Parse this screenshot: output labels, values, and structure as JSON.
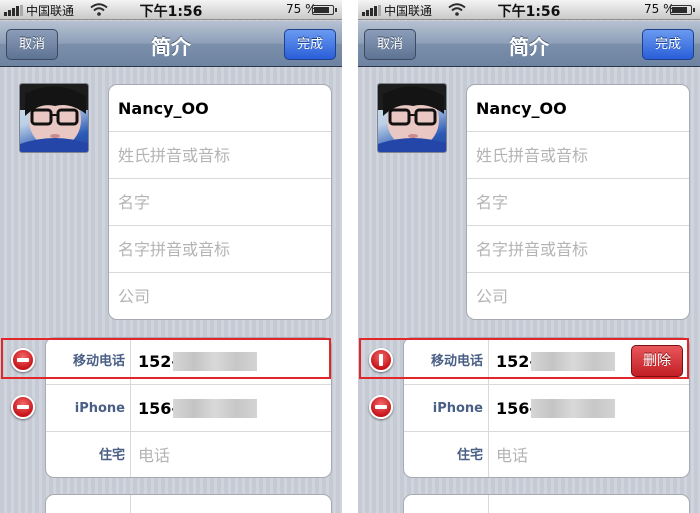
{
  "status_bar": {
    "carrier": "中国联通",
    "time": "下午1:56",
    "battery": "75 %",
    "battery_level": 0.75
  },
  "nav": {
    "title": "简介",
    "cancel": "取消",
    "done": "完成"
  },
  "name_fields": {
    "name": "Nancy_OO",
    "surname_phonetic_placeholder": "姓氏拼音或音标",
    "first_name_placeholder": "名字",
    "first_name_phonetic_placeholder": "名字拼音或音标",
    "company_placeholder": "公司"
  },
  "phones": [
    {
      "label": "移动电话",
      "value": "152-"
    },
    {
      "label": "iPhone",
      "value": "156-"
    },
    {
      "label": "住宅",
      "placeholder": "电话"
    }
  ],
  "delete_label": "删除",
  "colors": {
    "highlight": "#e2272b",
    "done_button": "#2a5ed8",
    "delete_badge": "#c8141a",
    "field_label": "#4a5f86"
  },
  "icons": [
    "signal-icon",
    "wifi-icon",
    "battery-icon",
    "minus-circle-icon",
    "avatar-photo"
  ]
}
